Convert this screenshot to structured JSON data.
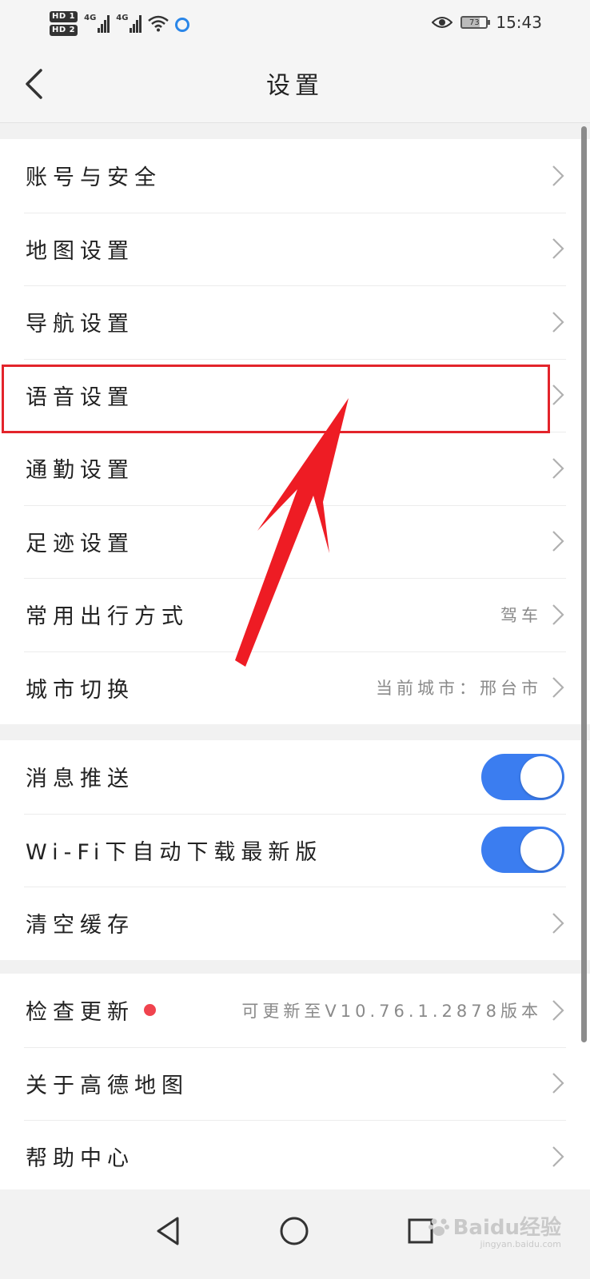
{
  "status_bar": {
    "hd1": "HD 1",
    "hd2": "HD 2",
    "net1": "4G",
    "net2": "4G",
    "battery": "73",
    "time": "15:43",
    "icons": [
      "signal-icon",
      "wifi-icon",
      "app-notification-icon",
      "eye-care-icon",
      "battery-icon"
    ]
  },
  "header": {
    "title": "设置",
    "back_icon": "chevron-left-icon"
  },
  "groups": [
    {
      "rows": [
        {
          "label": "账号与安全"
        },
        {
          "label": "地图设置"
        },
        {
          "label": "导航设置"
        },
        {
          "label": "语音设置"
        },
        {
          "label": "通勤设置"
        },
        {
          "label": "足迹设置"
        },
        {
          "label": "常用出行方式",
          "value": "驾车"
        },
        {
          "label": "城市切换",
          "value": "当前城市：邢台市"
        }
      ]
    },
    {
      "rows": [
        {
          "label": "消息推送",
          "toggle": true
        },
        {
          "label": "Wi-Fi下自动下载最新版",
          "toggle": true
        },
        {
          "label": "清空缓存"
        }
      ]
    },
    {
      "rows": [
        {
          "label": "检查更新",
          "badge": true,
          "value": "可更新至V10.76.1.2878版本"
        },
        {
          "label": "关于高德地图"
        },
        {
          "label": "帮助中心"
        }
      ]
    }
  ],
  "annotation": {
    "highlighted_row": "语音设置",
    "color": "#e3242b"
  },
  "nav_bar": {
    "icons": [
      "back-triangle-icon",
      "home-circle-icon",
      "recents-square-icon"
    ]
  },
  "watermark": {
    "brand": "Baidu经验",
    "url": "jingyan.baidu.com"
  },
  "colors": {
    "toggle_on": "#3b7df0",
    "badge_red": "#f0434e",
    "annotation_red": "#e3242b"
  }
}
